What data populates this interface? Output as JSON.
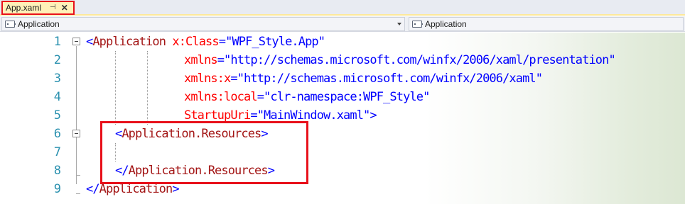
{
  "tab": {
    "label": "App.xaml",
    "pin_glyph": "⊣",
    "close_glyph": "✕"
  },
  "navbar": {
    "left_dropdown": "Application",
    "right_dropdown": "Application"
  },
  "editor": {
    "line_numbers": [
      "1",
      "2",
      "3",
      "4",
      "5",
      "6",
      "7",
      "8",
      "9"
    ],
    "lines": [
      {
        "open": "<",
        "tag": "Application",
        "sp": " ",
        "attr": "x:Class",
        "eq": "=",
        "val": "\"WPF_Style.App\""
      },
      {
        "attr": "xmlns",
        "eq": "=",
        "val": "\"http://schemas.microsoft.com/winfx/2006/xaml/presentation\""
      },
      {
        "attr": "xmlns:x",
        "eq": "=",
        "val": "\"http://schemas.microsoft.com/winfx/2006/xaml\""
      },
      {
        "attr": "xmlns:local",
        "eq": "=",
        "val": "\"clr-namespace:WPF_Style\""
      },
      {
        "attr": "StartupUri",
        "eq": "=",
        "val": "\"MainWindow.xaml\"",
        "close": ">"
      },
      {
        "open": "<",
        "tag": "Application.Resources",
        "close": ">"
      },
      {},
      {
        "open": "</",
        "tag": "Application.Resources",
        "close": ">"
      },
      {
        "open": "</",
        "tag": "Application",
        "close": ">"
      }
    ]
  },
  "colors": {
    "line_number": "#2b91af",
    "tag_name": "#a31515",
    "bracket": "#0000ff",
    "attribute": "#ff0000",
    "value": "#0000ff",
    "highlight_box": "#e8101a"
  }
}
